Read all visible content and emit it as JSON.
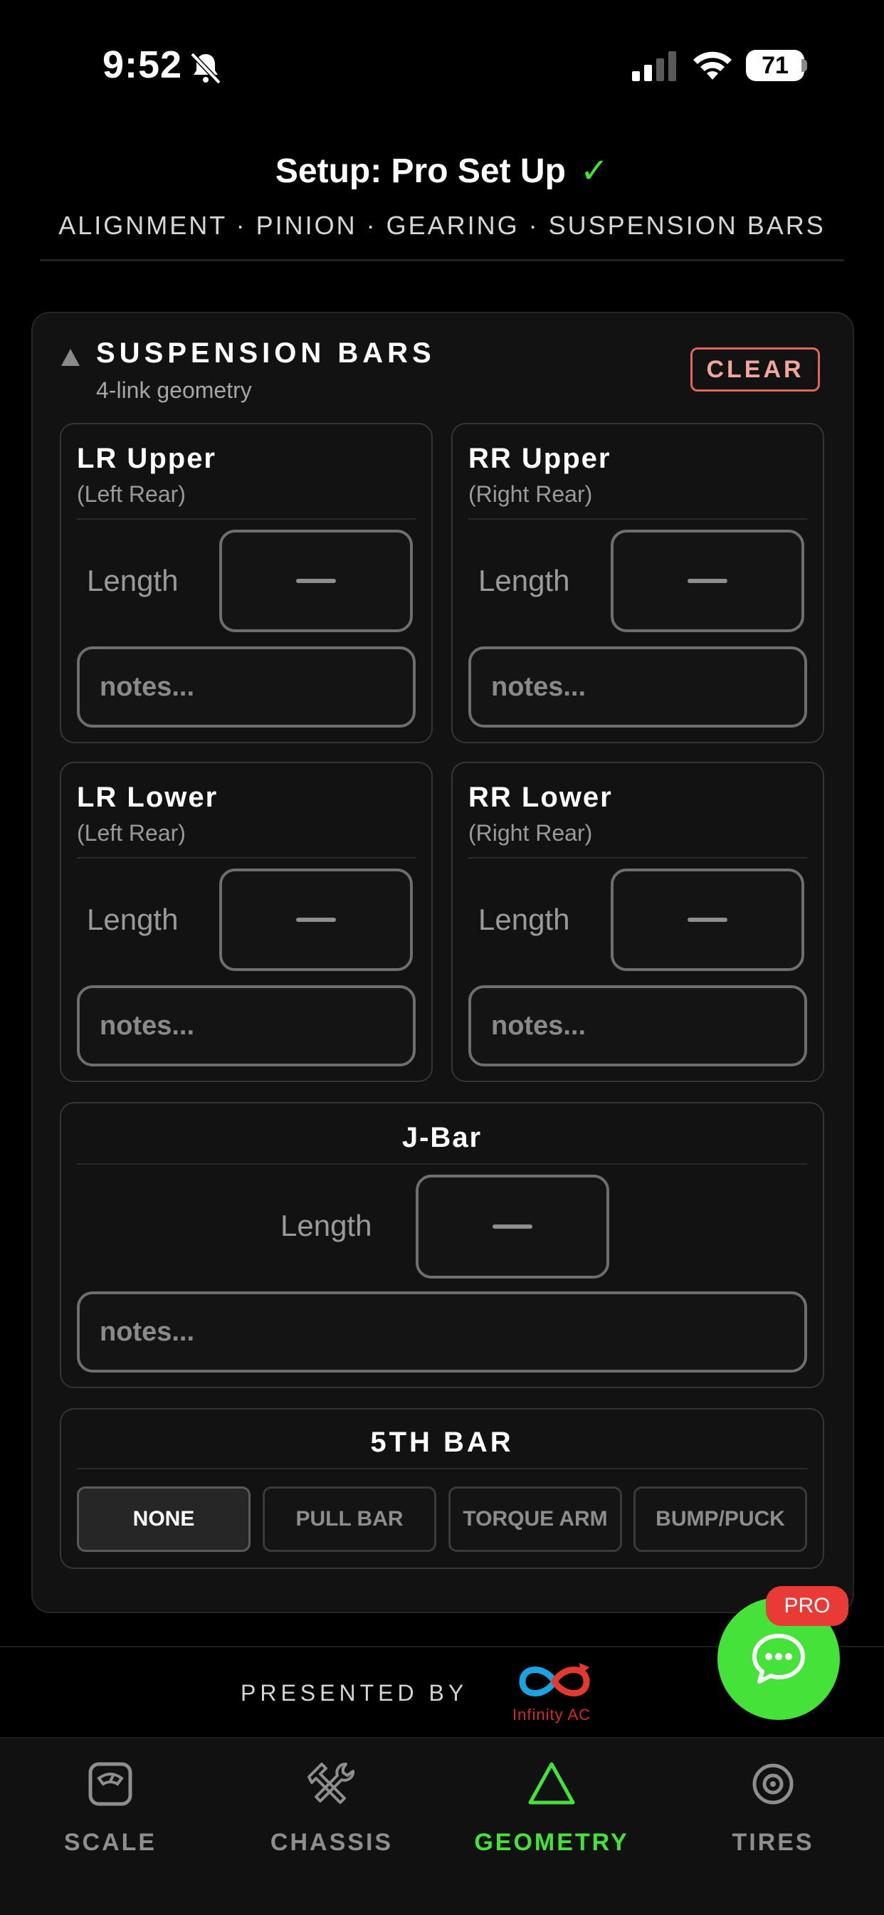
{
  "status_bar": {
    "time": "9:52",
    "battery": "71"
  },
  "header": {
    "title": "Setup: Pro Set Up",
    "check": "✓",
    "nav": "ALIGNMENT · PINION · GEARING · SUSPENSION BARS"
  },
  "section": {
    "title": "SUSPENSION BARS",
    "subtitle": "4-link geometry",
    "clear_label": "CLEAR"
  },
  "bars": {
    "lr_upper": {
      "name": "LR Upper",
      "sub": "(Left Rear)",
      "length_label": "Length",
      "notes_placeholder": "notes..."
    },
    "rr_upper": {
      "name": "RR Upper",
      "sub": "(Right Rear)",
      "length_label": "Length",
      "notes_placeholder": "notes..."
    },
    "lr_lower": {
      "name": "LR Lower",
      "sub": "(Left Rear)",
      "length_label": "Length",
      "notes_placeholder": "notes..."
    },
    "rr_lower": {
      "name": "RR Lower",
      "sub": "(Right Rear)",
      "length_label": "Length",
      "notes_placeholder": "notes..."
    },
    "j_bar": {
      "name": "J-Bar",
      "length_label": "Length",
      "notes_placeholder": "notes..."
    }
  },
  "fifth_bar": {
    "title": "5TH BAR",
    "options": [
      "NONE",
      "PULL BAR",
      "TORQUE ARM",
      "BUMP/PUCK"
    ],
    "selected": "NONE"
  },
  "presented_by": {
    "label": "PRESENTED BY",
    "logo_text": "Infinity AC"
  },
  "tabs": [
    {
      "label": "SCALE",
      "icon": "scale-icon"
    },
    {
      "label": "CHASSIS",
      "icon": "tools-icon"
    },
    {
      "label": "GEOMETRY",
      "icon": "triangle-icon"
    },
    {
      "label": "TIRES",
      "icon": "target-icon"
    }
  ],
  "active_tab": "GEOMETRY",
  "chat": {
    "badge": "PRO"
  },
  "colors": {
    "accent": "#45e23a",
    "danger": "#e0655a",
    "badge": "#ea3a36",
    "background": "#000000"
  }
}
